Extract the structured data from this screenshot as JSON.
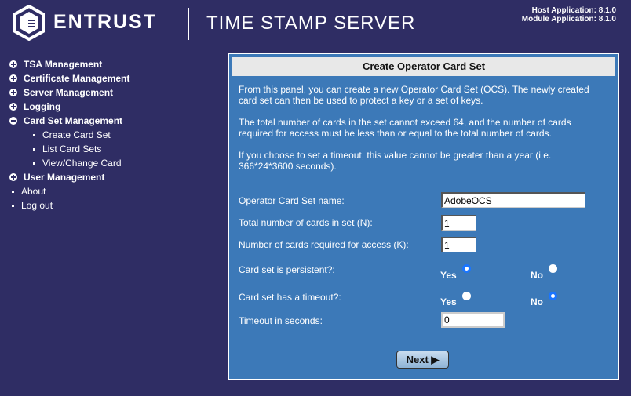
{
  "header": {
    "brand": "ENTRUST",
    "product": "TIME STAMP SERVER",
    "host_version": "Host Application: 8.1.0",
    "module_version": "Module Application: 8.1.0"
  },
  "nav": {
    "items": [
      {
        "label": "TSA Management",
        "state": "collapsed"
      },
      {
        "label": "Certificate Management",
        "state": "collapsed"
      },
      {
        "label": "Server Management",
        "state": "collapsed"
      },
      {
        "label": "Logging",
        "state": "collapsed"
      },
      {
        "label": "Card Set Management",
        "state": "expanded"
      },
      {
        "label": "Create Card Set"
      },
      {
        "label": "List Card Sets"
      },
      {
        "label": "View/Change Card"
      },
      {
        "label": "User Management",
        "state": "collapsed"
      },
      {
        "label": "About"
      },
      {
        "label": "Log out"
      }
    ]
  },
  "panel": {
    "title": "Create Operator Card Set",
    "desc": [
      "From this panel, you can create a new Operator Card Set (OCS). The newly created card set can then be used to protect a key or a set of keys.",
      "The total number of cards in the set cannot exceed 64, and the number of cards required for access must be less than or equal to the total number of cards.",
      "If you choose to set a timeout, this value cannot be greater than a year (i.e. 366*24*3600 seconds)."
    ],
    "fields": {
      "name_label": "Operator Card Set name:",
      "name_value": "AdobeOCS",
      "total_label": "Total number of cards in set (N):",
      "total_value": "1",
      "required_label": "Number of cards required for access (K):",
      "required_value": "1",
      "persistent_label": "Card set is persistent?:",
      "persistent_selected": "Yes",
      "timeout_q_label": "Card set has a timeout?:",
      "timeout_q_selected": "No",
      "timeout_label": "Timeout in seconds:",
      "timeout_value": "0",
      "yes": "Yes",
      "no": "No"
    },
    "next_label": "Next"
  }
}
